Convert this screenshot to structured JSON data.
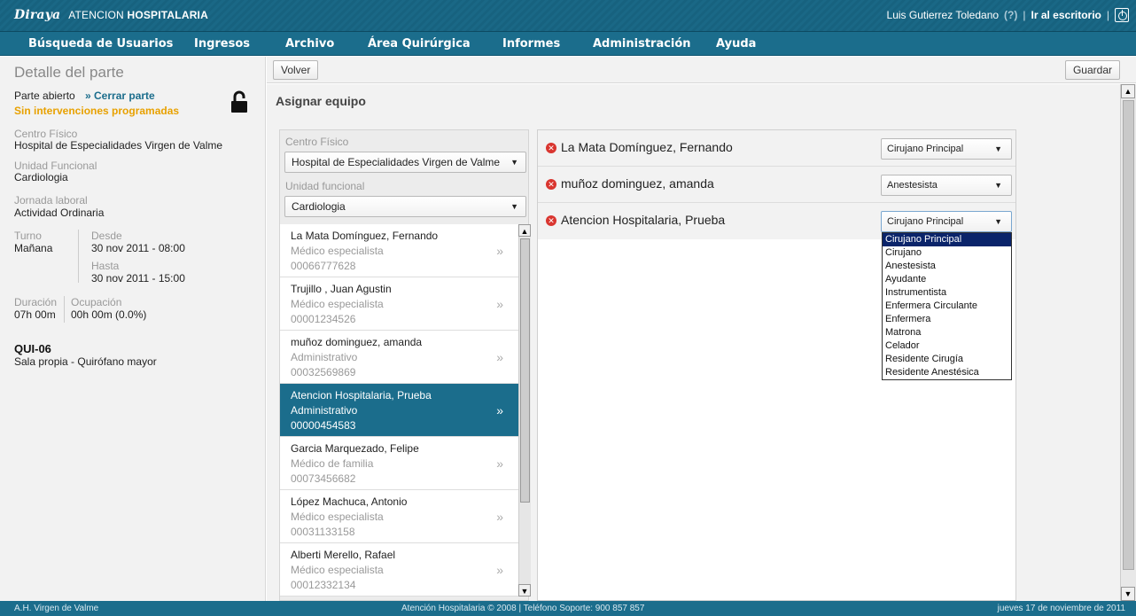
{
  "header": {
    "brand_logo": "Diraya",
    "brand_app": "ATENCION",
    "brand_app_bold": "HOSPITALARIA",
    "user_name": "Luis Gutierrez Toledano",
    "help_mark": "(?)",
    "sep": "|",
    "desktop_link": "Ir al escritorio"
  },
  "menu": {
    "items": [
      "Búsqueda de Usuarios",
      "Ingresos",
      "Archivo",
      "Área Quirúrgica",
      "Informes",
      "Administración",
      "Ayuda"
    ]
  },
  "left": {
    "title": "Detalle del parte",
    "status": "Parte abierto",
    "close_link": "» Cerrar parte",
    "no_interventions": "Sin intervenciones programadas",
    "centro_label": "Centro Físico",
    "centro_value": "Hospital de Especialidades Virgen de Valme",
    "unidad_label": "Unidad Funcional",
    "unidad_value": "Cardiologia",
    "jornada_label": "Jornada laboral",
    "jornada_value": "Actividad Ordinaria",
    "turno_label": "Turno",
    "turno_value": "Mañana",
    "desde_label": "Desde",
    "desde_value": "30 nov 2011 - 08:00",
    "hasta_label": "Hasta",
    "hasta_value": "30 nov 2011 - 15:00",
    "duracion_label": "Duración",
    "duracion_value": "07h 00m",
    "ocupacion_label": "Ocupación",
    "ocupacion_value": "00h 00m (0.0%)",
    "room_code": "QUI-06",
    "room_desc": "Sala propia  -  Quirófano mayor"
  },
  "toolbar": {
    "back_label": "Volver",
    "save_label": "Guardar"
  },
  "content": {
    "title": "Asignar equipo",
    "centro_label": "Centro Físico",
    "centro_value": "Hospital de Especialidades Virgen de Valme",
    "unidad_label": "Unidad funcional",
    "unidad_value": "Cardiologia",
    "people": [
      {
        "name": "La Mata Domínguez, Fernando",
        "role": "Médico especialista",
        "id": "00066777628"
      },
      {
        "name": "Trujillo , Juan Agustin",
        "role": "Médico especialista",
        "id": "00001234526"
      },
      {
        "name": "muñoz dominguez, amanda",
        "role": "Administrativo",
        "id": "00032569869"
      },
      {
        "name": "Atencion Hospitalaria, Prueba",
        "role": "Administrativo",
        "id": "00000454583"
      },
      {
        "name": "Garcia Marquezado, Felipe",
        "role": "Médico de familia",
        "id": "00073456682"
      },
      {
        "name": "López Machuca, Antonio",
        "role": "Médico especialista",
        "id": "00031133158"
      },
      {
        "name": "Alberti Merello, Rafael",
        "role": "Médico especialista",
        "id": "00012332134"
      }
    ],
    "arrow_glyph": "»",
    "assigned": [
      {
        "name": "La Mata Domínguez, Fernando",
        "role": "Cirujano Principal"
      },
      {
        "name": "muñoz dominguez, amanda",
        "role": "Anestesista"
      },
      {
        "name": "Atencion Hospitalaria, Prueba",
        "role": "Cirujano Principal"
      }
    ],
    "role_options": [
      "Cirujano Principal",
      "Cirujano",
      "Anestesista",
      "Ayudante",
      "Instrumentista",
      "Enfermera Circulante",
      "Enfermera",
      "Matrona",
      "Celador",
      "Residente Cirugía",
      "Residente Anestésica"
    ]
  },
  "footer": {
    "left": "A.H. Virgen de Valme",
    "center": "Atención Hospitalaria © 2008 | Teléfono Soporte: 900 857 857",
    "right": "jueves 17 de noviembre de 2011"
  },
  "colors": {
    "brand": "#1b6d8c",
    "warning": "#e8a100",
    "remove": "#d9352f"
  }
}
